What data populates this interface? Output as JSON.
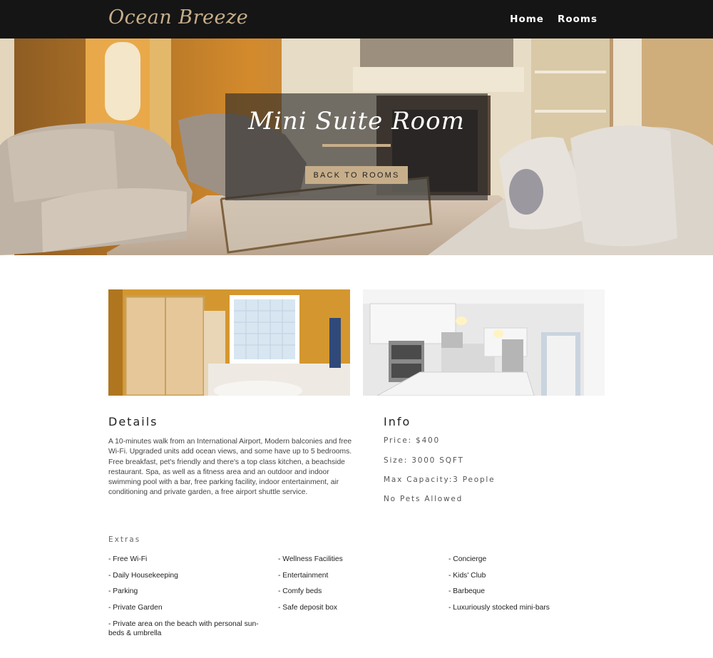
{
  "nav": {
    "brand": "Ocean Breeze",
    "links": [
      "Home",
      "Rooms"
    ]
  },
  "hero": {
    "title": "Mini Suite Room",
    "button": "BACK TO ROOMS"
  },
  "details": {
    "heading": "Details",
    "text": "A 10-minutes walk from an International Airport, Modern balconies and free Wi-Fi. Upgraded units add ocean views, and some have up to 5 bedrooms. Free breakfast, pet's friendly and there's a top class kitchen, a beachside restaurant. Spa, as well as a fitness area and an outdoor and indoor swimming pool with a bar, free parking facility, indoor entertainment, air conditioning and private garden, a free airport shuttle service."
  },
  "info": {
    "heading": "Info",
    "lines": [
      "Price: $400",
      "Size: 3000 SQFT",
      "Max Capacity:3 People",
      "No Pets Allowed"
    ]
  },
  "extras": {
    "title": "Extras",
    "items": [
      "- Free Wi-Fi",
      "- Wellness Facilities",
      "- Concierge",
      "- Daily Housekeeping",
      "- Entertainment",
      "- Kids' Club",
      "- Parking",
      "- Comfy beds",
      "- Barbeque",
      "- Private Garden",
      "- Safe deposit box",
      "- Luxuriously stocked mini-bars",
      "- Private area on the beach with personal sun-beds & umbrella"
    ]
  },
  "colors": {
    "accent": "#c7ae8a",
    "navbar": "#151515"
  }
}
